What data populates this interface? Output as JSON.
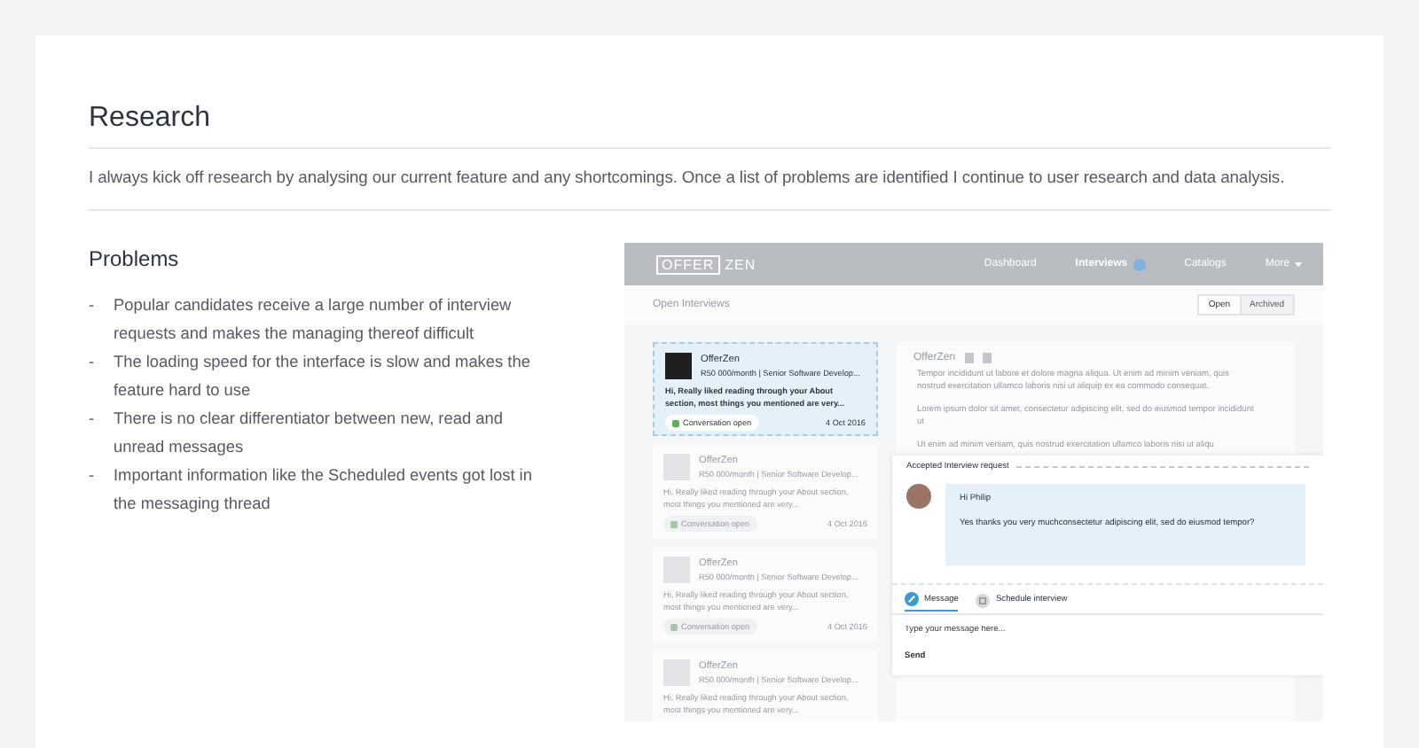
{
  "section": {
    "title": "Research",
    "intro": "I always kick off research by analysing our current feature and any shortcomings. Once a list of problems are identified I continue to user research and data analysis."
  },
  "problems": {
    "heading": "Problems",
    "items": [
      {
        "bullet": "-",
        "text": "Popular candidates receive a large number of interview requests and makes the managing thereof difficult"
      },
      {
        "bullet": "-",
        "text": "The loading speed for the interface is slow and makes the feature hard to use"
      },
      {
        "bullet": "-",
        "text": "There is no clear differentiator between new, read and unread messages"
      },
      {
        "bullet": "-",
        "text": "Important information like the Scheduled events got lost in the messaging thread"
      }
    ]
  },
  "mockup": {
    "logo": [
      "OFFER",
      "ZEN"
    ],
    "nav": [
      {
        "label": "Dashboard",
        "selected": false,
        "kind": "plain"
      },
      {
        "label": "Interviews",
        "selected": true,
        "kind": "badge"
      },
      {
        "label": "Catalogs",
        "selected": false,
        "kind": "plain"
      },
      {
        "label": "More",
        "selected": false,
        "kind": "dropdown"
      }
    ],
    "page_title": "Open Interviews",
    "toggle": [
      {
        "label": "Open",
        "selected": true
      },
      {
        "label": "Archived",
        "selected": false
      }
    ],
    "cards": [
      {
        "selected": true,
        "company": "OfferZen",
        "role": "R50 000/month | Senior Software Develop...",
        "message": "Hi, Really liked reading through your About section, most things you mentioned are very...",
        "status": "Conversation open",
        "date": "4 Oct 2016"
      },
      {
        "selected": false,
        "company": "OfferZen",
        "role": "R50 000/month | Senior Software Develop...",
        "message": "Hi, Really liked reading through your About section, most things you mentioned are very...",
        "status": "Conversation open",
        "date": "4 Oct 2016"
      },
      {
        "selected": false,
        "company": "OfferZen",
        "role": "R50 000/month | Senior Software Develop...",
        "message": "Hi, Really liked reading through your About section, most things you mentioned are very...",
        "status": "Conversation open",
        "date": "4 Oct 2016"
      },
      {
        "selected": false,
        "company": "OfferZen",
        "role": "R50 000/month | Senior Software Develop...",
        "message": "Hi, Really liked reading through your About section, most things you mentioned are very..."
      }
    ],
    "thread": {
      "company": "OfferZen",
      "paragraphs": [
        "Tempor incididunt ut labore et dolore magna aliqua. Ut enim ad minim veniam, quis nostrud exercitation ullamco laboris nisi ut aliquip ex ea commodo consequat.",
        "Lorem ipsum dolor sit amet, consectetur adipiscing elit, sed do eiusmod tempor incididunt ut",
        "Ut enim ad minim veniam, quis nostrud exercitation ullamco laboris nisi ut aliqu"
      ]
    },
    "request": {
      "heading": "Accepted Interview request",
      "greeting": "Hi Philip",
      "body": "Yes thanks you very muchconsectetur adipiscing elit, sed do eiusmod tempor?",
      "tabs": [
        {
          "label": "Message",
          "selected": true,
          "kind": "message"
        },
        {
          "label": "Schedule interview",
          "selected": false,
          "kind": "calendar"
        }
      ],
      "placeholder": "Type your message here...",
      "send": "Send"
    }
  }
}
